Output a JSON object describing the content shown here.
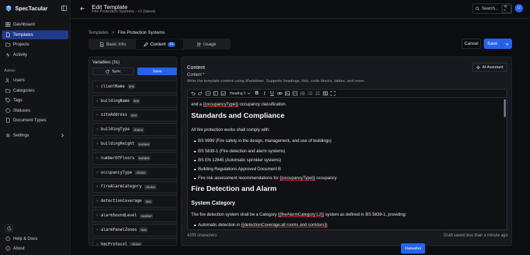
{
  "app": {
    "name": "SpecTacular"
  },
  "sidebar": {
    "items": [
      {
        "label": "Dashboard",
        "icon": "dashboard-icon"
      },
      {
        "label": "Templates",
        "icon": "file-icon",
        "active": true
      },
      {
        "label": "Projects",
        "icon": "folder-icon"
      },
      {
        "label": "Activity",
        "icon": "activity-icon"
      }
    ],
    "admin_label": "Admin",
    "admin_items": [
      {
        "label": "Users",
        "icon": "users-icon"
      },
      {
        "label": "Categories",
        "icon": "folder-icon"
      },
      {
        "label": "Tags",
        "icon": "tag-icon"
      },
      {
        "label": "Statuses",
        "icon": "circle-icon"
      },
      {
        "label": "Document Types",
        "icon": "file-icon"
      }
    ],
    "settings_label": "Settings",
    "help_label": "Help & Docs",
    "about_label": "About"
  },
  "header": {
    "title": "Edit Template",
    "subtitle": "Fire Protection Systems - v1 (latest)",
    "search_label": "Search...",
    "search_kbd": "⌘ K",
    "avatar_initial": "U"
  },
  "breadcrumb": {
    "root": "Templates",
    "sep": ">",
    "current": "Fire Protection Systems"
  },
  "tabs": [
    {
      "label": "Basic Info"
    },
    {
      "label": "Content",
      "badge": "31",
      "active": true
    },
    {
      "label": "Usage"
    }
  ],
  "actions": {
    "cancel": "Cancel",
    "save": "Save"
  },
  "variables": {
    "title": "Variables (31)",
    "sync_label": "Sync",
    "save_label": "Save",
    "items": [
      {
        "name": "clientName",
        "type": "text"
      },
      {
        "name": "buildingName",
        "type": "text"
      },
      {
        "name": "siteAddress",
        "type": "text"
      },
      {
        "name": "buildingType",
        "type": "choice"
      },
      {
        "name": "buildingHeight",
        "type": "number"
      },
      {
        "name": "numberOfFloors",
        "type": "number"
      },
      {
        "name": "occupancyType",
        "type": "choice"
      },
      {
        "name": "fireAlarmCategory",
        "type": "choice"
      },
      {
        "name": "detectionCoverage",
        "type": "text"
      },
      {
        "name": "alarmSoundLevel",
        "type": "number"
      },
      {
        "name": "alarmPanelZones",
        "type": "text"
      },
      {
        "name": "hmcProtocol",
        "type": "choice"
      }
    ]
  },
  "content": {
    "title": "Content",
    "ai_label": "AI Assistant",
    "field_label": "Content *",
    "help": "Write the template content using Markdown. Supports headings, lists, code blocks, tables, and more.",
    "heading_select": "Heading 2",
    "doc": {
      "line1_pre": "and a ",
      "line1_ph": "{{occupancyType}}",
      "line1_post": " occupancy classification.",
      "h1a": "Standards and Compliance",
      "p1": "All fire protection works shall comply with:",
      "list1": [
        "BS 9999 (Fire safety in the design, management, and use of buildings)",
        "BS 5839-1 (Fire detection and alarm systems)",
        "BS EN 12845 (Automatic sprinkler systems)",
        "Building Regulations Approved Document B"
      ],
      "list1_last_pre": "Fire risk assessment recommendations for ",
      "list1_last_ph": "{{occupancyType}}",
      "list1_last_post": " occupancy",
      "h1b": "Fire Detection and Alarm",
      "h2": "System Category",
      "p2_pre": "The fire detection system shall be a Category ",
      "p2_ph": "{{fireAlarmCategory:L2}}",
      "p2_post": " system as defined in BS 5839-1, providing:",
      "li_pre": "Automatic detection in ",
      "li_ph": "{{detectionCoverage:all rooms and corridors}}"
    },
    "char_count": "4205 characters",
    "draft_status": "Draft saved less than a minute ago"
  },
  "overlay": {
    "flameshot": "Flameshot"
  },
  "colors": {
    "accent": "#2563eb",
    "background": "#0b0d10",
    "panel": "#16191d"
  }
}
